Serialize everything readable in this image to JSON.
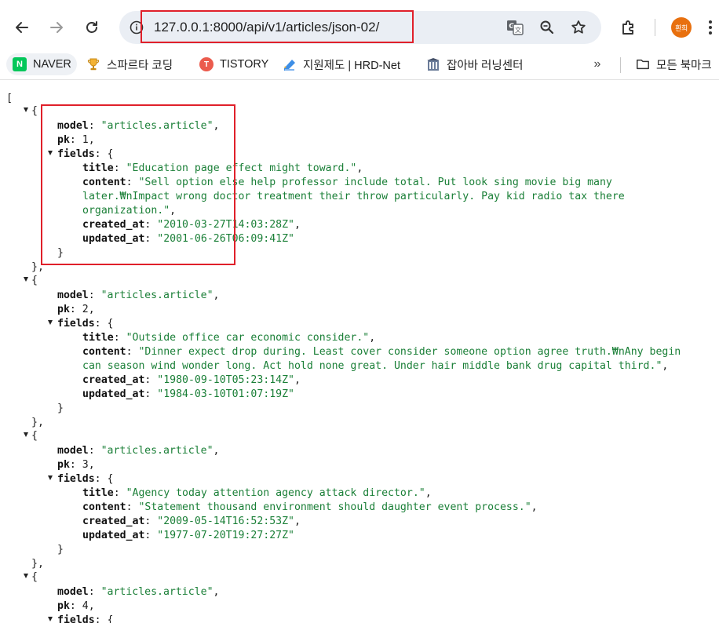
{
  "browser": {
    "url": "127.0.0.1:8000/api/v1/articles/json-02/",
    "profile_initials": "환희",
    "bookmarks": [
      {
        "label": "NAVER",
        "icon": "naver-icon"
      },
      {
        "label": "스파르타 코딩",
        "icon": "trophy-icon"
      },
      {
        "label": "TISTORY",
        "icon": "tistory-icon"
      },
      {
        "label": "지원제도 | HRD-Net",
        "icon": "hrdnet-icon"
      },
      {
        "label": "잡아바 러닝센터",
        "icon": "building-icon"
      }
    ],
    "all_bookmarks_label": "모든 북마크"
  },
  "json": {
    "open_bracket": "[",
    "articles": [
      {
        "model": "\"articles.article\"",
        "pk": "1",
        "title": "\"Education page effect might toward.\"",
        "content_lines": [
          "\"Sell option else help professor include total. Put look sing movie big many",
          "later.₩nImpact wrong doctor treatment their throw particularly. Pay kid radio tax there",
          "organization.\""
        ],
        "created_at": "\"2010-03-27T14:03:28Z\"",
        "updated_at": "\"2001-06-26T06:09:41Z\""
      },
      {
        "model": "\"articles.article\"",
        "pk": "2",
        "title": "\"Outside office car economic consider.\"",
        "content_lines": [
          "\"Dinner expect drop during. Least cover consider someone option agree truth.₩nAny begin",
          "can season wind wonder long. Act hold none great. Under hair middle bank drug capital third.\""
        ],
        "created_at": "\"1980-09-10T05:23:14Z\"",
        "updated_at": "\"1984-03-10T01:07:19Z\""
      },
      {
        "model": "\"articles.article\"",
        "pk": "3",
        "title": "\"Agency today attention agency attack director.\"",
        "content_lines": [
          "\"Statement thousand environment should daughter event process.\""
        ],
        "created_at": "\"2009-05-14T16:52:53Z\"",
        "updated_at": "\"1977-07-20T19:27:27Z\""
      },
      {
        "model": "\"articles.article\"",
        "pk": "4"
      }
    ],
    "keys": {
      "model": "model",
      "pk": "pk",
      "fields": "fields",
      "title": "title",
      "content": "content",
      "created_at": "created_at",
      "updated_at": "updated_at"
    }
  },
  "colors": {
    "highlight": "#e0202a",
    "string": "#1a7f37",
    "naver": "#03c75a",
    "avatar": "#e8700f"
  }
}
